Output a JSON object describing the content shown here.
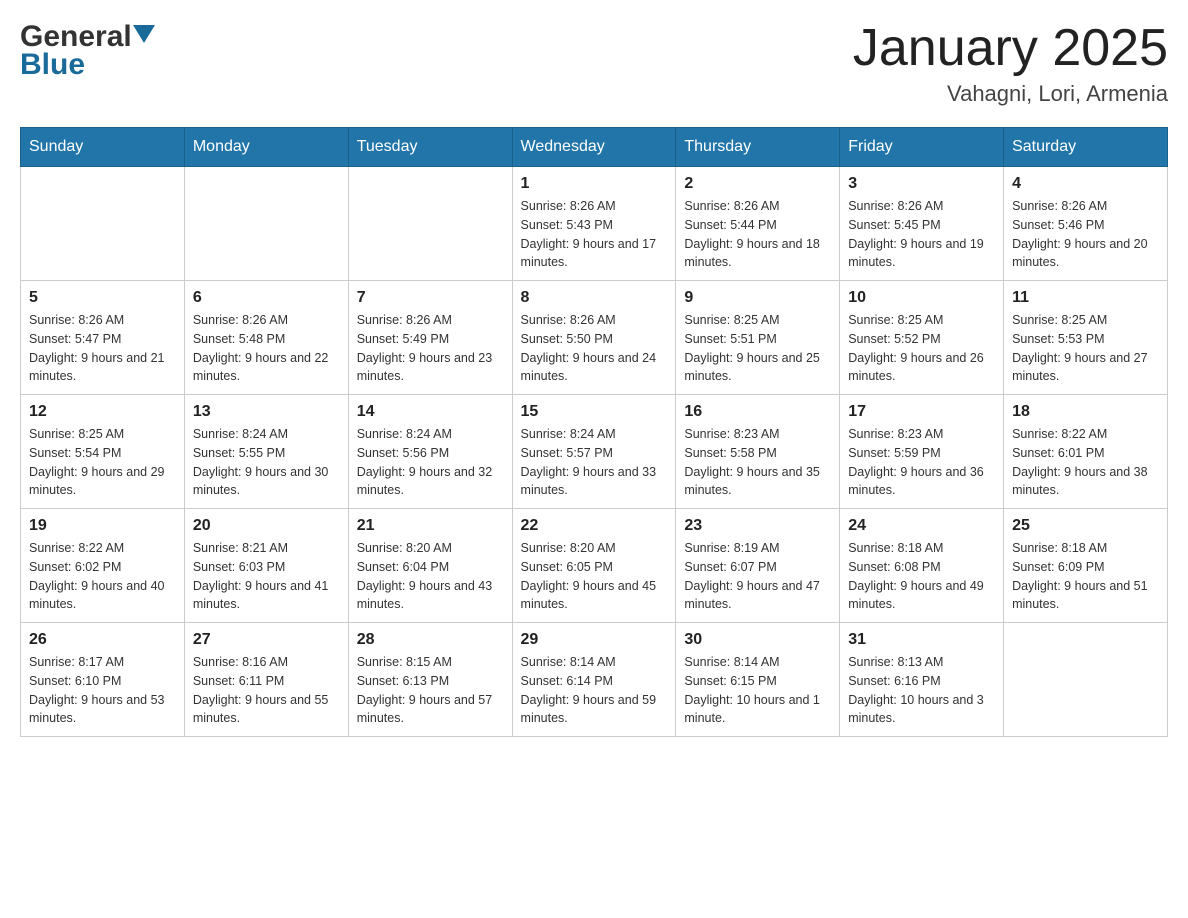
{
  "header": {
    "logo_general": "General",
    "logo_blue": "Blue",
    "month_title": "January 2025",
    "location": "Vahagni, Lori, Armenia"
  },
  "days_of_week": [
    "Sunday",
    "Monday",
    "Tuesday",
    "Wednesday",
    "Thursday",
    "Friday",
    "Saturday"
  ],
  "weeks": [
    [
      {
        "day": "",
        "sunrise": "",
        "sunset": "",
        "daylight": ""
      },
      {
        "day": "",
        "sunrise": "",
        "sunset": "",
        "daylight": ""
      },
      {
        "day": "",
        "sunrise": "",
        "sunset": "",
        "daylight": ""
      },
      {
        "day": "1",
        "sunrise": "Sunrise: 8:26 AM",
        "sunset": "Sunset: 5:43 PM",
        "daylight": "Daylight: 9 hours and 17 minutes."
      },
      {
        "day": "2",
        "sunrise": "Sunrise: 8:26 AM",
        "sunset": "Sunset: 5:44 PM",
        "daylight": "Daylight: 9 hours and 18 minutes."
      },
      {
        "day": "3",
        "sunrise": "Sunrise: 8:26 AM",
        "sunset": "Sunset: 5:45 PM",
        "daylight": "Daylight: 9 hours and 19 minutes."
      },
      {
        "day": "4",
        "sunrise": "Sunrise: 8:26 AM",
        "sunset": "Sunset: 5:46 PM",
        "daylight": "Daylight: 9 hours and 20 minutes."
      }
    ],
    [
      {
        "day": "5",
        "sunrise": "Sunrise: 8:26 AM",
        "sunset": "Sunset: 5:47 PM",
        "daylight": "Daylight: 9 hours and 21 minutes."
      },
      {
        "day": "6",
        "sunrise": "Sunrise: 8:26 AM",
        "sunset": "Sunset: 5:48 PM",
        "daylight": "Daylight: 9 hours and 22 minutes."
      },
      {
        "day": "7",
        "sunrise": "Sunrise: 8:26 AM",
        "sunset": "Sunset: 5:49 PM",
        "daylight": "Daylight: 9 hours and 23 minutes."
      },
      {
        "day": "8",
        "sunrise": "Sunrise: 8:26 AM",
        "sunset": "Sunset: 5:50 PM",
        "daylight": "Daylight: 9 hours and 24 minutes."
      },
      {
        "day": "9",
        "sunrise": "Sunrise: 8:25 AM",
        "sunset": "Sunset: 5:51 PM",
        "daylight": "Daylight: 9 hours and 25 minutes."
      },
      {
        "day": "10",
        "sunrise": "Sunrise: 8:25 AM",
        "sunset": "Sunset: 5:52 PM",
        "daylight": "Daylight: 9 hours and 26 minutes."
      },
      {
        "day": "11",
        "sunrise": "Sunrise: 8:25 AM",
        "sunset": "Sunset: 5:53 PM",
        "daylight": "Daylight: 9 hours and 27 minutes."
      }
    ],
    [
      {
        "day": "12",
        "sunrise": "Sunrise: 8:25 AM",
        "sunset": "Sunset: 5:54 PM",
        "daylight": "Daylight: 9 hours and 29 minutes."
      },
      {
        "day": "13",
        "sunrise": "Sunrise: 8:24 AM",
        "sunset": "Sunset: 5:55 PM",
        "daylight": "Daylight: 9 hours and 30 minutes."
      },
      {
        "day": "14",
        "sunrise": "Sunrise: 8:24 AM",
        "sunset": "Sunset: 5:56 PM",
        "daylight": "Daylight: 9 hours and 32 minutes."
      },
      {
        "day": "15",
        "sunrise": "Sunrise: 8:24 AM",
        "sunset": "Sunset: 5:57 PM",
        "daylight": "Daylight: 9 hours and 33 minutes."
      },
      {
        "day": "16",
        "sunrise": "Sunrise: 8:23 AM",
        "sunset": "Sunset: 5:58 PM",
        "daylight": "Daylight: 9 hours and 35 minutes."
      },
      {
        "day": "17",
        "sunrise": "Sunrise: 8:23 AM",
        "sunset": "Sunset: 5:59 PM",
        "daylight": "Daylight: 9 hours and 36 minutes."
      },
      {
        "day": "18",
        "sunrise": "Sunrise: 8:22 AM",
        "sunset": "Sunset: 6:01 PM",
        "daylight": "Daylight: 9 hours and 38 minutes."
      }
    ],
    [
      {
        "day": "19",
        "sunrise": "Sunrise: 8:22 AM",
        "sunset": "Sunset: 6:02 PM",
        "daylight": "Daylight: 9 hours and 40 minutes."
      },
      {
        "day": "20",
        "sunrise": "Sunrise: 8:21 AM",
        "sunset": "Sunset: 6:03 PM",
        "daylight": "Daylight: 9 hours and 41 minutes."
      },
      {
        "day": "21",
        "sunrise": "Sunrise: 8:20 AM",
        "sunset": "Sunset: 6:04 PM",
        "daylight": "Daylight: 9 hours and 43 minutes."
      },
      {
        "day": "22",
        "sunrise": "Sunrise: 8:20 AM",
        "sunset": "Sunset: 6:05 PM",
        "daylight": "Daylight: 9 hours and 45 minutes."
      },
      {
        "day": "23",
        "sunrise": "Sunrise: 8:19 AM",
        "sunset": "Sunset: 6:07 PM",
        "daylight": "Daylight: 9 hours and 47 minutes."
      },
      {
        "day": "24",
        "sunrise": "Sunrise: 8:18 AM",
        "sunset": "Sunset: 6:08 PM",
        "daylight": "Daylight: 9 hours and 49 minutes."
      },
      {
        "day": "25",
        "sunrise": "Sunrise: 8:18 AM",
        "sunset": "Sunset: 6:09 PM",
        "daylight": "Daylight: 9 hours and 51 minutes."
      }
    ],
    [
      {
        "day": "26",
        "sunrise": "Sunrise: 8:17 AM",
        "sunset": "Sunset: 6:10 PM",
        "daylight": "Daylight: 9 hours and 53 minutes."
      },
      {
        "day": "27",
        "sunrise": "Sunrise: 8:16 AM",
        "sunset": "Sunset: 6:11 PM",
        "daylight": "Daylight: 9 hours and 55 minutes."
      },
      {
        "day": "28",
        "sunrise": "Sunrise: 8:15 AM",
        "sunset": "Sunset: 6:13 PM",
        "daylight": "Daylight: 9 hours and 57 minutes."
      },
      {
        "day": "29",
        "sunrise": "Sunrise: 8:14 AM",
        "sunset": "Sunset: 6:14 PM",
        "daylight": "Daylight: 9 hours and 59 minutes."
      },
      {
        "day": "30",
        "sunrise": "Sunrise: 8:14 AM",
        "sunset": "Sunset: 6:15 PM",
        "daylight": "Daylight: 10 hours and 1 minute."
      },
      {
        "day": "31",
        "sunrise": "Sunrise: 8:13 AM",
        "sunset": "Sunset: 6:16 PM",
        "daylight": "Daylight: 10 hours and 3 minutes."
      },
      {
        "day": "",
        "sunrise": "",
        "sunset": "",
        "daylight": ""
      }
    ]
  ]
}
